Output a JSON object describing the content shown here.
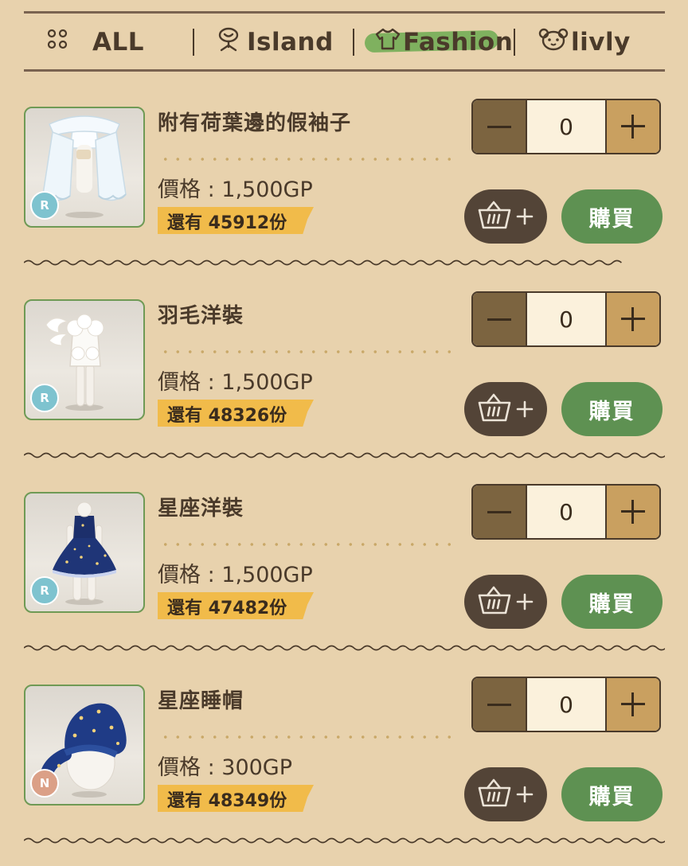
{
  "tabs": [
    {
      "label": "ALL",
      "icon": "grid-dots-icon"
    },
    {
      "label": "Island",
      "icon": "tree-icon"
    },
    {
      "label": "Fashion",
      "icon": "shirt-icon",
      "active": true
    },
    {
      "label": "livly",
      "icon": "livly-face-icon"
    }
  ],
  "colors": {
    "background": "#e8d2ad",
    "buy_button": "#5e9152",
    "cart_button": "#534437",
    "stock_tag": "#f1bb4a",
    "active_tab_highlight": "#7fb15f"
  },
  "items": [
    {
      "name": "附有荷葉邊的假袖子",
      "price": "價格 : 1,500GP",
      "stock": "還有 45912份",
      "rarity": "R",
      "quantity": "0",
      "buy_label": "購買",
      "thumb": "ruffled-sleeves"
    },
    {
      "name": "羽毛洋裝",
      "price": "價格 : 1,500GP",
      "stock": "還有 48326份",
      "rarity": "R",
      "quantity": "0",
      "buy_label": "購買",
      "thumb": "feather-dress"
    },
    {
      "name": "星座洋裝",
      "price": "價格 : 1,500GP",
      "stock": "還有 47482份",
      "rarity": "R",
      "quantity": "0",
      "buy_label": "購買",
      "thumb": "constellation-dress"
    },
    {
      "name": "星座睡帽",
      "price": "價格 : 300GP",
      "stock": "還有 48349份",
      "rarity": "N",
      "quantity": "0",
      "buy_label": "購買",
      "thumb": "constellation-nightcap"
    }
  ]
}
